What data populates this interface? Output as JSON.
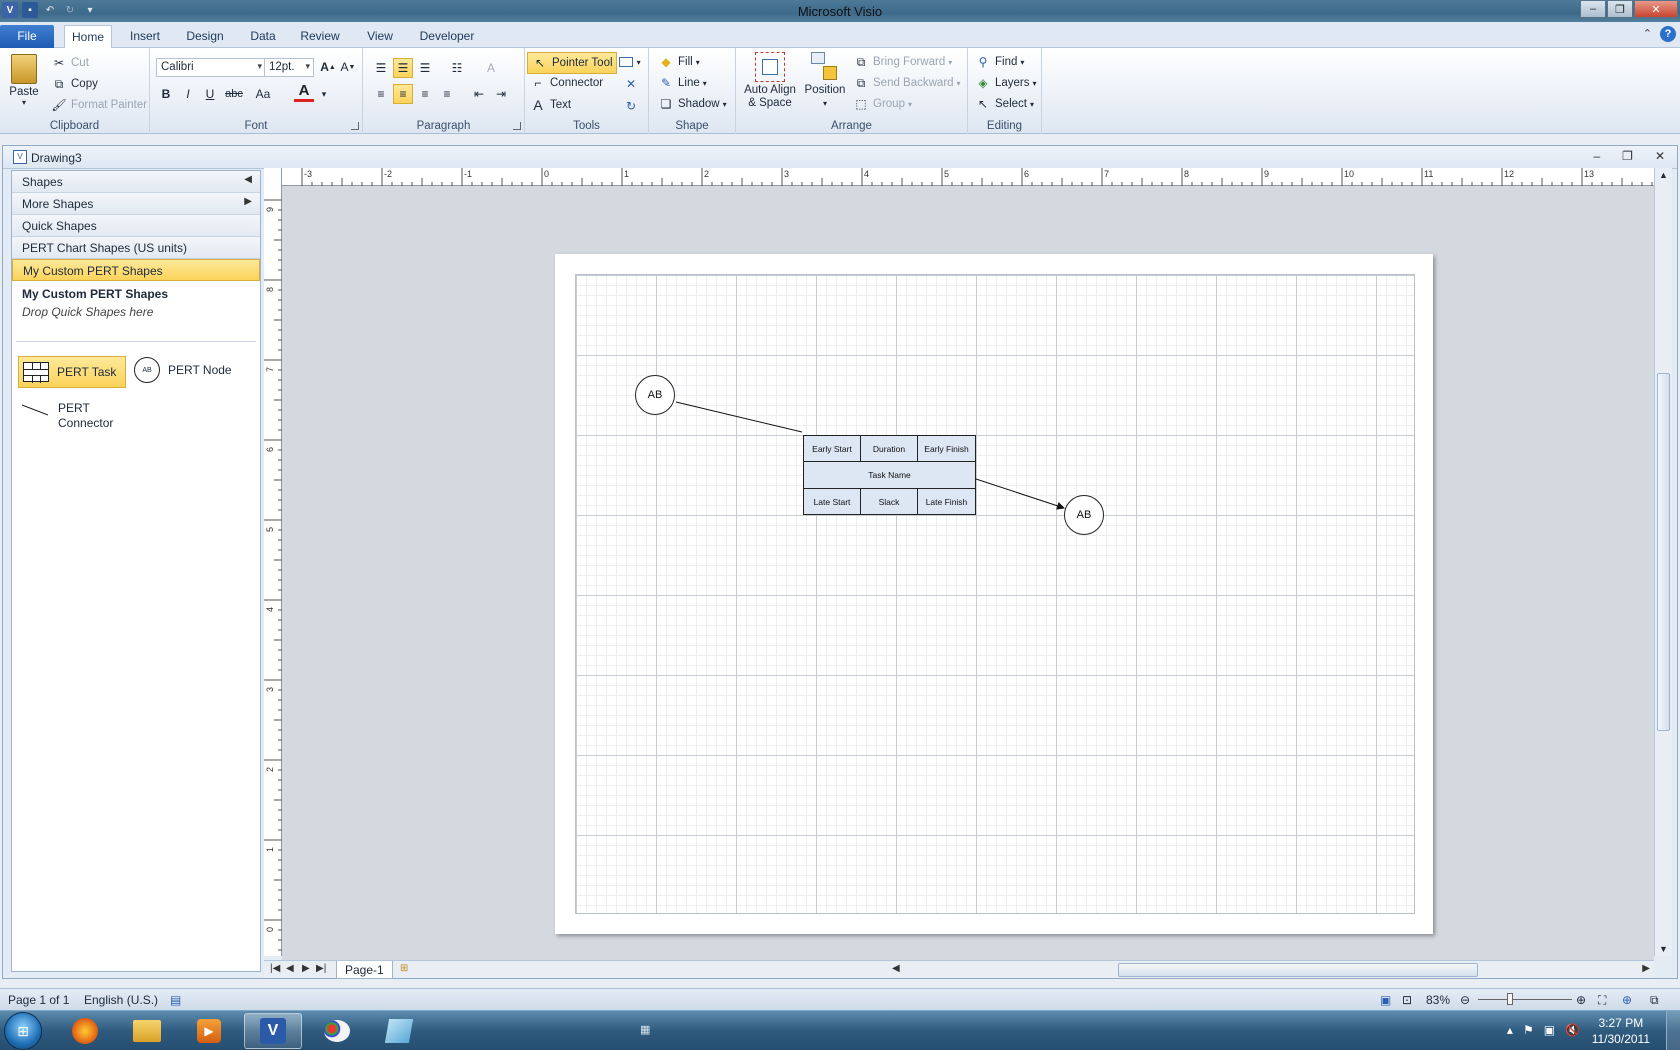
{
  "app": {
    "title": "Microsoft Visio"
  },
  "tabs": [
    "File",
    "Home",
    "Insert",
    "Design",
    "Data",
    "Review",
    "View",
    "Developer"
  ],
  "ribbon": {
    "clipboard": {
      "paste": "Paste",
      "cut": "Cut",
      "copy": "Copy",
      "format_painter": "Format Painter",
      "label": "Clipboard"
    },
    "font": {
      "family": "Calibri",
      "size": "12pt.",
      "bold": "B",
      "italic": "I",
      "underline": "U",
      "strike": "abc",
      "case": "Aa",
      "label": "Font"
    },
    "paragraph": {
      "label": "Paragraph"
    },
    "tools": {
      "pointer": "Pointer Tool",
      "connector": "Connector",
      "text": "Text",
      "label": "Tools"
    },
    "shape": {
      "fill": "Fill",
      "line": "Line",
      "shadow": "Shadow",
      "label": "Shape"
    },
    "arrange": {
      "auto_align_1": "Auto Align",
      "auto_align_2": "& Space",
      "position": "Position",
      "bring_forward": "Bring Forward",
      "send_backward": "Send Backward",
      "group": "Group",
      "label": "Arrange"
    },
    "editing": {
      "find": "Find",
      "layers": "Layers",
      "select": "Select",
      "label": "Editing"
    }
  },
  "document": {
    "title": "Drawing3"
  },
  "shapes_pane": {
    "header": "Shapes",
    "more_shapes": "More Shapes",
    "quick_shapes": "Quick Shapes",
    "pert_chart": "PERT Chart Shapes (US units)",
    "custom": "My Custom PERT Shapes",
    "stencil_title": "My Custom PERT Shapes",
    "drop_hint": "Drop Quick Shapes here",
    "items": {
      "task": "PERT Task",
      "node": "PERT Node",
      "node_icon": "AB",
      "connector_1": "PERT",
      "connector_2": "Connector"
    }
  },
  "ruler": {
    "h_ticks": [
      "-3",
      "-2",
      "-1",
      "0",
      "1",
      "2",
      "3",
      "4",
      "5",
      "6",
      "7",
      "8",
      "9",
      "10",
      "11",
      "12",
      "13"
    ],
    "v_ticks": [
      "9",
      "8",
      "7",
      "6",
      "5",
      "4",
      "3",
      "2",
      "1",
      "0"
    ]
  },
  "diagram": {
    "node_a": "AB",
    "node_b": "AB",
    "task": {
      "early_start": "Early Start",
      "duration": "Duration",
      "early_finish": "Early Finish",
      "task_name": "Task Name",
      "late_start": "Late Start",
      "slack": "Slack",
      "late_finish": "Late Finish"
    }
  },
  "page_tabs": {
    "current": "Page-1"
  },
  "status": {
    "page": "Page 1 of 1",
    "language": "English (U.S.)",
    "zoom": "83%"
  },
  "taskbar": {
    "time": "3:27 PM",
    "date": "11/30/2011"
  }
}
